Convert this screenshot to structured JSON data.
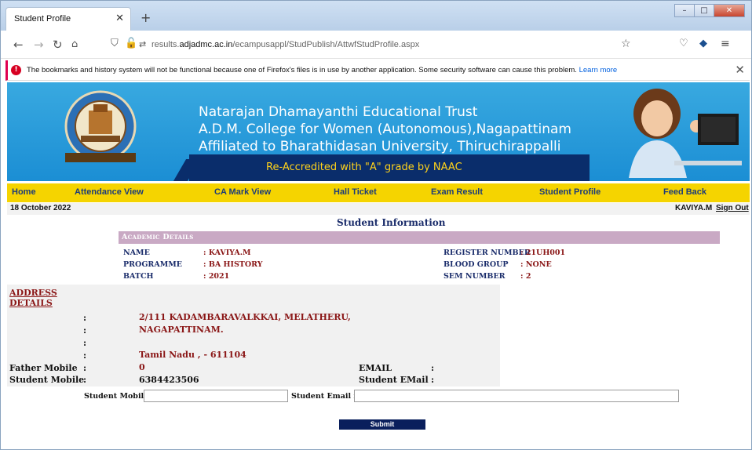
{
  "browser": {
    "tab_title": "Student Profile",
    "url_prefix": "results.",
    "url_host": "adjadmc.ac.in",
    "url_path": "/ecampusappl/StudPublish/AttwfStudProfile.aspx",
    "notification": "The bookmarks and history system will not be functional because one of Firefox's files is in use by another application. Some security software can cause this problem.",
    "notification_link": "Learn more"
  },
  "banner": {
    "line1": "Natarajan Dhamayanthi Educational Trust",
    "line2": "A.D.M. College for Women (Autonomous),Nagapattinam",
    "line3": "Affiliated to Bharathidasan University, Thiruchirappalli",
    "naac": "Re-Accredited with \"A\" grade by NAAC"
  },
  "menu": [
    "Home",
    "Attendance View",
    "CA Mark View",
    "Hall Ticket",
    "Exam Result",
    "Student Profile",
    "Feed Back"
  ],
  "status": {
    "date": "18 October 2022",
    "user": "KAVIYA.M",
    "signout": "Sign Out"
  },
  "page": {
    "heading": "Student Information",
    "academic_title": "Academic Details",
    "academic": {
      "name_label": "NAME",
      "name_value": ": KAVIYA.M",
      "programme_label": "PROGRAMME",
      "programme_value": ": BA HISTORY",
      "batch_label": "BATCH",
      "batch_value": ": 2021",
      "register_label": "REGISTER NUMBER",
      "register_value": ": 21UH001",
      "blood_label": "BLOOD GROUP",
      "blood_value": ": NONE",
      "sem_label": "SEM NUMBER",
      "sem_value": ": 2"
    },
    "address_title_1": "ADDRESS",
    "address_title_2": "DETAILS",
    "address_line1": "2/111 KADAMBARAVALKKAI, MELATHERU,",
    "address_line2": "NAGAPATTINAM.",
    "address_line3": "Tamil Nadu , - 611104",
    "father_mobile_label": "Father Mobile",
    "father_mobile_value": "0",
    "student_mobile_label": "Student Mobile",
    "student_mobile_value": "6384423506",
    "email_label": "EMAIL",
    "student_email_label": "Student EMail",
    "colon": ":",
    "form": {
      "mobile_label": "Student Mobile",
      "email_label": "Student Email id",
      "mobile_value": "",
      "email_value": "",
      "submit": "Submit"
    }
  }
}
